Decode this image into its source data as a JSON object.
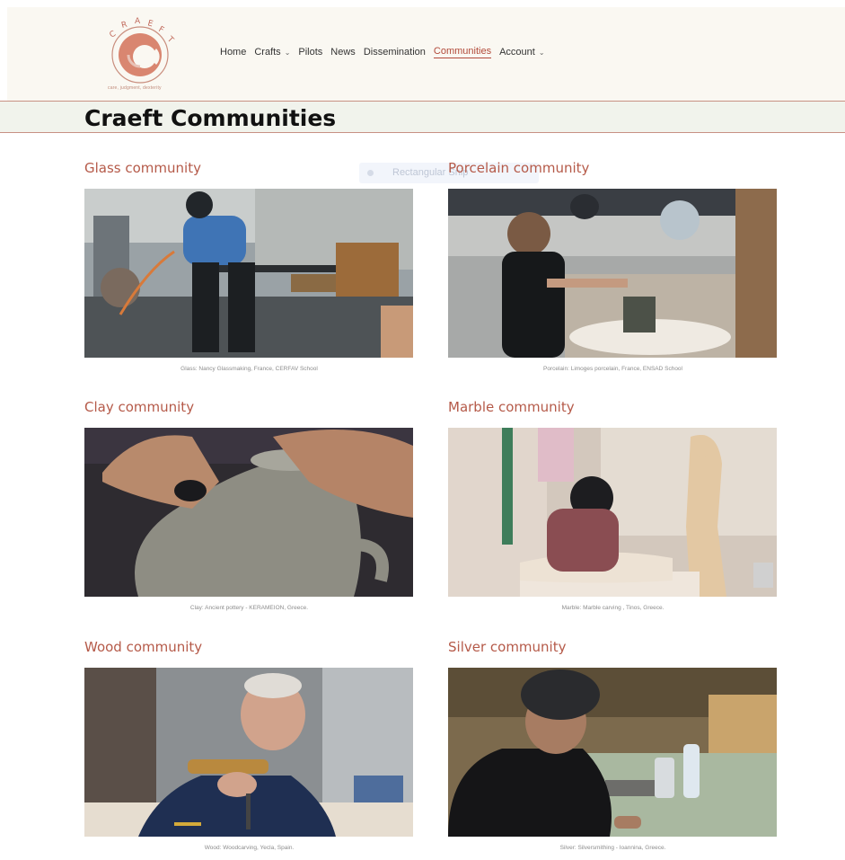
{
  "brand": {
    "logo_letters": "CRAEFT",
    "tagline": "care, judgment, dexterity",
    "accent": "#b24a3a"
  },
  "nav": {
    "items": [
      {
        "label": "Home",
        "dropdown": false,
        "active": false
      },
      {
        "label": "Crafts",
        "dropdown": true,
        "active": false
      },
      {
        "label": "Pilots",
        "dropdown": false,
        "active": false
      },
      {
        "label": "News",
        "dropdown": false,
        "active": false
      },
      {
        "label": "Dissemination",
        "dropdown": false,
        "active": false
      },
      {
        "label": "Communities",
        "dropdown": false,
        "active": true
      },
      {
        "label": "Account",
        "dropdown": true,
        "active": false
      }
    ],
    "chevron": "⌄"
  },
  "page": {
    "title": "Craeft Communities",
    "ghost_label": "Rectangular Snip"
  },
  "communities": [
    {
      "heading": "Glass community",
      "caption": "Glass: Nancy Glassmaking, France, CERFAV School",
      "icon": "glassblower-photo"
    },
    {
      "heading": "Porcelain community",
      "caption": "Porcelain: Limoges porcelain, France, ENSAD School",
      "icon": "porcelain-photo"
    },
    {
      "heading": "Clay community",
      "caption": "Clay: Ancient pottery - KERAMEION, Greece.",
      "icon": "pottery-photo"
    },
    {
      "heading": "Marble community",
      "caption": "Marble: Marble carving , Tinos, Greece.",
      "icon": "marble-photo"
    },
    {
      "heading": "Wood community",
      "caption": "Wood: Woodcarving, Yecla, Spain.",
      "icon": "woodcarving-photo"
    },
    {
      "heading": "Silver community",
      "caption": "Silver: Silversmithing - Ioannina, Greece.",
      "icon": "silversmith-photo"
    }
  ]
}
